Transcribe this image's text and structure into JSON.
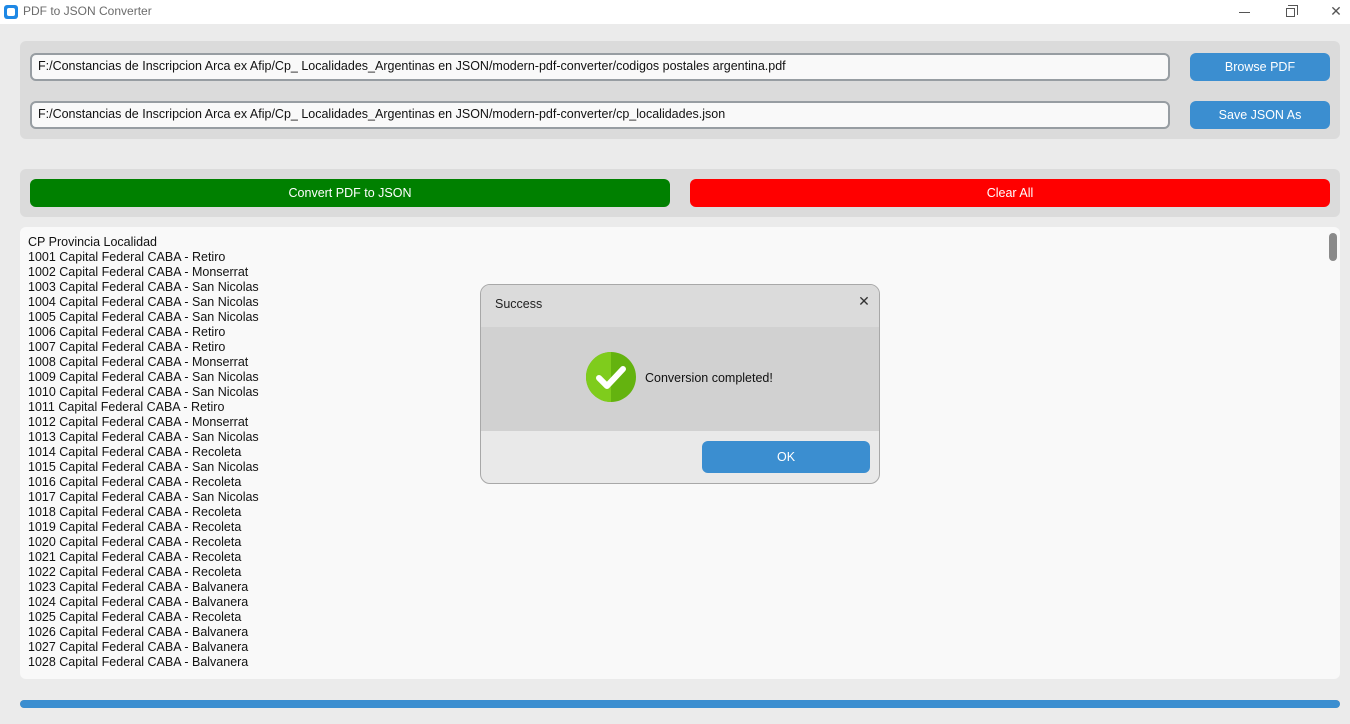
{
  "window": {
    "title": "PDF to JSON Converter",
    "minimize_icon": "minimize-icon",
    "maximize_icon": "restore-icon",
    "close_icon": "close-icon"
  },
  "paths": {
    "pdf_path": "F:/Constancias de Inscripcion Arca ex Afip/Cp_ Localidades_Argentinas en JSON/modern-pdf-converter/codigos postales argentina.pdf",
    "json_path": "F:/Constancias de Inscripcion Arca ex Afip/Cp_ Localidades_Argentinas en JSON/modern-pdf-converter/cp_localidades.json",
    "browse_label": "Browse PDF",
    "save_label": "Save JSON As"
  },
  "actions": {
    "convert_label": "Convert PDF to JSON",
    "clear_label": "Clear All",
    "convert_color": "#008000",
    "clear_color": "#ff0000"
  },
  "output": {
    "lines": [
      "CP Provincia Localidad",
      "1001 Capital Federal CABA - Retiro",
      "1002 Capital Federal CABA - Monserrat",
      "1003 Capital Federal CABA - San Nicolas",
      "1004 Capital Federal CABA - San Nicolas",
      "1005 Capital Federal CABA - San Nicolas",
      "1006 Capital Federal CABA - Retiro",
      "1007 Capital Federal CABA - Retiro",
      "1008 Capital Federal CABA - Monserrat",
      "1009 Capital Federal CABA - San Nicolas",
      "1010 Capital Federal CABA - San Nicolas",
      "1011 Capital Federal CABA - Retiro",
      "1012 Capital Federal CABA - Monserrat",
      "1013 Capital Federal CABA - San Nicolas",
      "1014 Capital Federal CABA - Recoleta",
      "1015 Capital Federal CABA - San Nicolas",
      "1016 Capital Federal CABA - Recoleta",
      "1017 Capital Federal CABA - San Nicolas",
      "1018 Capital Federal CABA - Recoleta",
      "1019 Capital Federal CABA - Recoleta",
      "1020 Capital Federal CABA - Recoleta",
      "1021 Capital Federal CABA - Recoleta",
      "1022 Capital Federal CABA - Recoleta",
      "1023 Capital Federal CABA - Balvanera",
      "1024 Capital Federal CABA - Balvanera",
      "1025 Capital Federal CABA - Recoleta",
      "1026 Capital Federal CABA - Balvanera",
      "1027 Capital Federal CABA - Balvanera",
      "1028 Capital Federal CABA - Balvanera"
    ]
  },
  "progress": {
    "value": 1.0,
    "color": "#3b8ed0"
  },
  "dialog": {
    "title": "Success",
    "message": "Conversion completed!",
    "ok_label": "OK",
    "icon": "checkmark-icon",
    "close_icon": "close-icon"
  }
}
